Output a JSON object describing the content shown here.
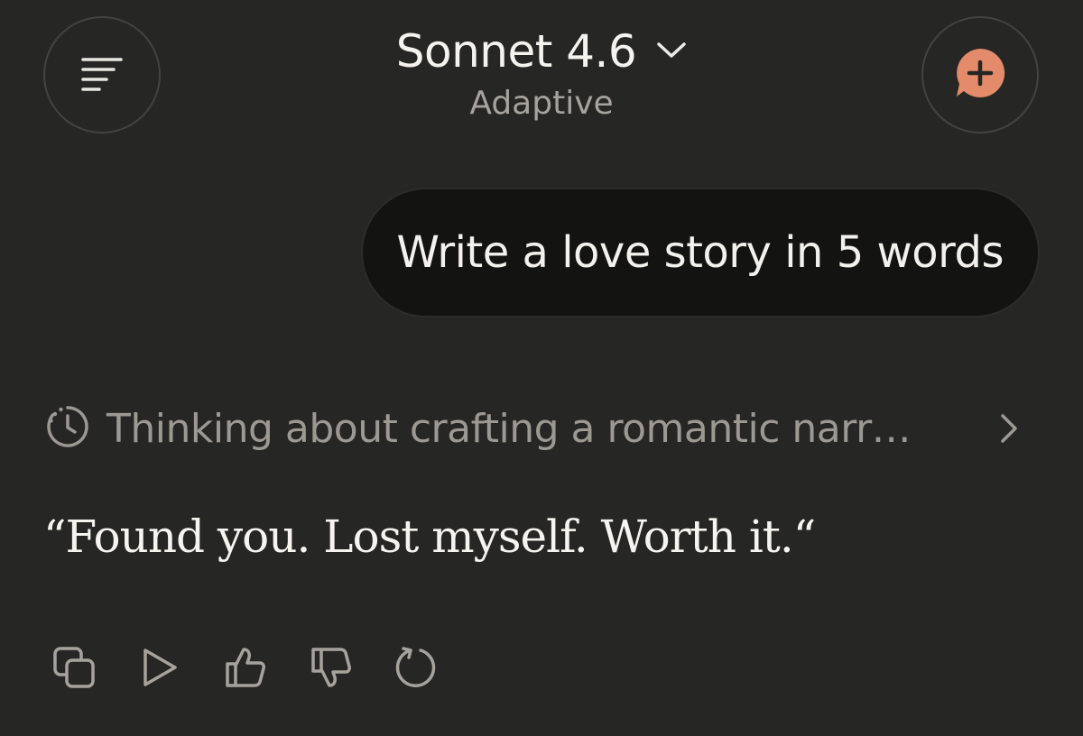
{
  "header": {
    "model_name": "Sonnet 4.6",
    "model_mode": "Adaptive",
    "menu_icon": "menu-icon",
    "new_chat_icon": "new-chat-icon",
    "accent_color": "#e38b6b"
  },
  "conversation": {
    "user_message": "Write a love story in 5 words",
    "thinking_summary": "Thinking about crafting a romantic narr…",
    "response_text": "“Found you. Lost myself. Worth it.“"
  },
  "message_actions": [
    {
      "name": "copy",
      "icon": "copy-icon"
    },
    {
      "name": "read-aloud",
      "icon": "play-icon"
    },
    {
      "name": "thumbs-up",
      "icon": "thumbs-up-icon"
    },
    {
      "name": "thumbs-down",
      "icon": "thumbs-down-icon"
    },
    {
      "name": "retry",
      "icon": "retry-icon"
    }
  ]
}
